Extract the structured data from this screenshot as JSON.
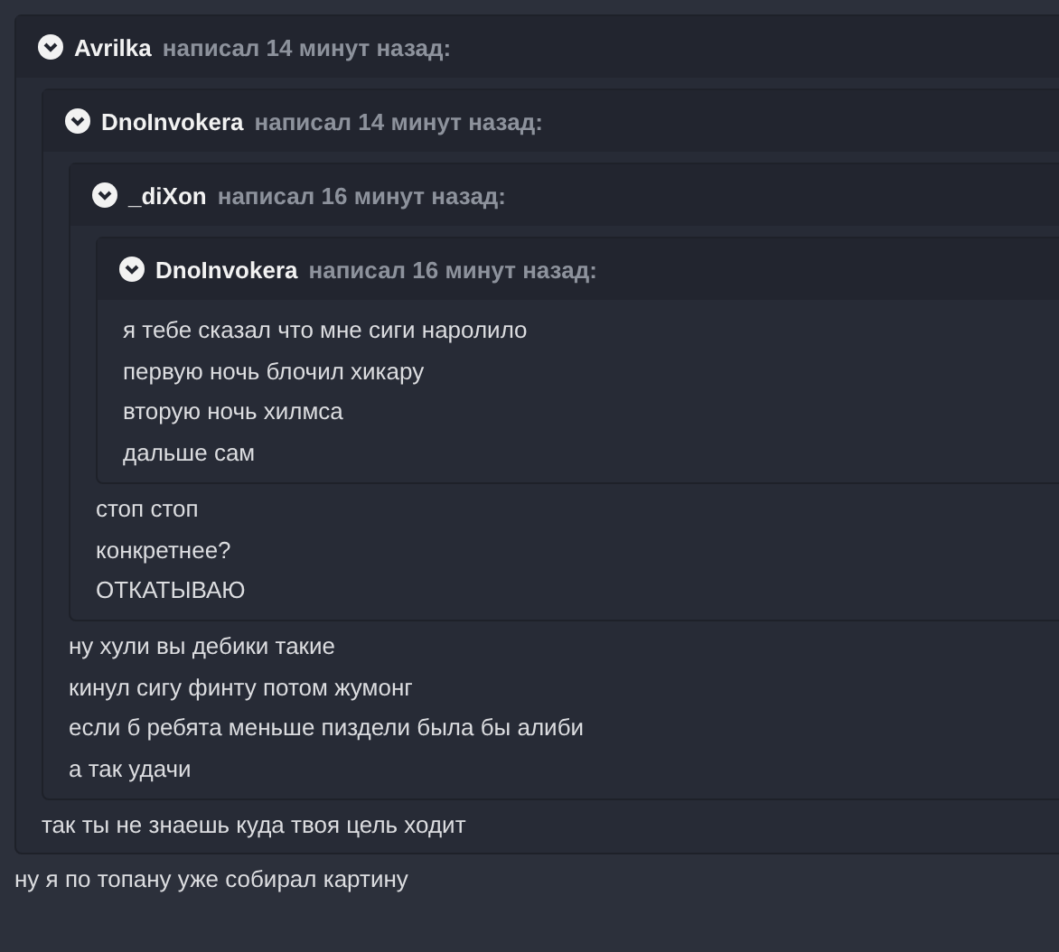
{
  "quote": {
    "author": "Avrilka",
    "meta": "написал 14 минут назад:",
    "expanded": true,
    "quote": {
      "author": "DnoInvokera",
      "meta": "написал 14 минут назад:",
      "expanded": true,
      "quote": {
        "author": "_diXon",
        "meta": "написал 16 минут назад:",
        "expanded": true,
        "quote": {
          "author": "DnoInvokera",
          "meta": "написал 16 минут назад:",
          "expanded": true,
          "lines": [
            "я тебе сказал что мне сиги наролило",
            "первую ночь блочил хикару",
            "вторую ночь хилмса",
            "дальше сам"
          ]
        },
        "lines": [
          "стоп стоп",
          "конкретнее?",
          "ОТКАТЫВАЮ"
        ]
      },
      "lines": [
        "ну хули вы дебики такие",
        "кинул сигу финту потом жумонг",
        "если б ребята меньше пиздели была бы алиби",
        "а так удачи"
      ]
    },
    "lines": [
      "так ты не знаешь куда твоя цель ходит"
    ]
  },
  "lines": [
    "ну я по топану уже собирал картину"
  ]
}
